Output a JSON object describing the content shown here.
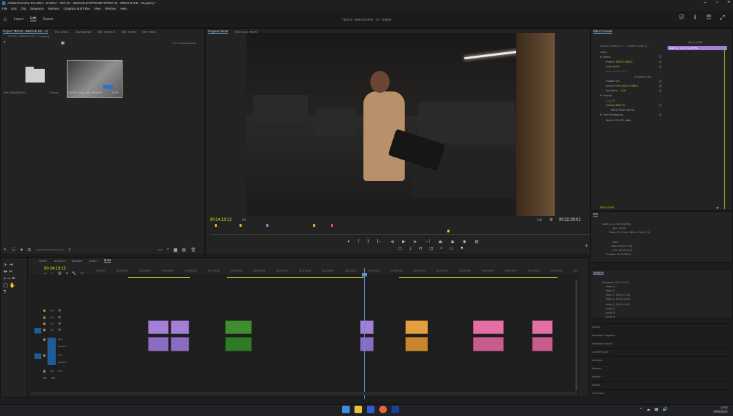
{
  "window": {
    "title": "Adobe Premiere Pro 2024 - E:\\2024 - TEC-IO - INNOV4LIFE\\PROJETO\\TECH3 - INNOV4LIFE - V1.prproj *"
  },
  "menu": [
    "File",
    "Edit",
    "Clip",
    "Sequence",
    "Markers",
    "Graphics and Titles",
    "View",
    "Window",
    "Help"
  ],
  "workspace": {
    "tabs": [
      "Import",
      "Edit",
      "Export"
    ],
    "active": "Edit",
    "project_title": "TECH3 - INNOV4LIFE - V1 - Edited"
  },
  "project_panel": {
    "tabs": [
      "Project: TECH3 - INNOV4LIFE - V1",
      "Bin: SARA",
      "Bin: ELENO",
      "Bin: NATALIA",
      "Bin: SARA",
      "Bin: TECH"
    ],
    "path": "TECH3 - INNOV4LIFE - V1.prproj",
    "search_placeholder": "",
    "selected_count": "1 of 2 items selected",
    "items": [
      {
        "name": "ENCERRAMENTO",
        "kind": "Folder",
        "meta": "9 items"
      },
      {
        "name": "INTRO_FULL_HD_FRONTE",
        "kind": "Clip",
        "meta": "10:00"
      }
    ]
  },
  "program_monitor": {
    "tabs": [
      "Program: MAIN",
      "Reference: MAIN"
    ],
    "timecode": "00:14:13:12",
    "fit": "Fit",
    "quality": "Full",
    "duration": "00:22:39:02"
  },
  "effect_controls": {
    "title": "Effect Controls",
    "source": "Source • CAM_A_17... • MAIN • CAM_A...",
    "timecode": "00:14:12:00",
    "clip_label": "CAM_A_17:00 FLORIPA",
    "rows": [
      {
        "label": "Video",
        "value": ""
      },
      {
        "label": "fx Motion",
        "value": ""
      },
      {
        "label": "Position",
        "value": "1920.0   1080.0"
      },
      {
        "label": "Scale",
        "value": "100.0"
      },
      {
        "label": "Scale Width",
        "value": "100.0"
      },
      {
        "label": "",
        "value": "Uniform Sc..."
      },
      {
        "label": "Rotation",
        "value": "0.0"
      },
      {
        "label": "Anchor Point",
        "value": "1920.0   1080.0"
      },
      {
        "label": "Anti-flicker...",
        "value": "0.00"
      },
      {
        "label": "fx Opacity",
        "value": ""
      },
      {
        "label": "Opacity",
        "value": "100.0 %"
      },
      {
        "label": "Blend Mode",
        "value": "Normal"
      },
      {
        "label": "fx Time Remapping",
        "value": ""
      },
      {
        "label": "Speed",
        "value": "100.00%"
      }
    ],
    "footer_tc": "00:14:13:12"
  },
  "info_panel": {
    "title": "Info",
    "lines": [
      "CAM_A_17:00 FLORIPA",
      "Type: Movie",
      "Video: 25.00 fps, 3840 x 2160 (1.0)",
      "Tape:",
      "Start: 00:14:07:04",
      "End: 00:14:16:00",
      "Duration: 00:00:08:22"
    ]
  },
  "markers_panel": {
    "title": "Markers",
    "lines": [
      "Sequence: 00:14:13:12",
      "Video 4:",
      "Video 3:",
      "Video 2: 00:00:17:23",
      "Video 1: 00:14:16:00",
      "Audio 1: 00:14:16:00",
      "Audio 2:",
      "Audio 3:",
      "Audio 4:"
    ]
  },
  "side_panels": [
    "Effects",
    "Essential Graphics",
    "Essential Sound",
    "Lumetri Color",
    "Libraries",
    "Markers",
    "History",
    "Events",
    "Timecode"
  ],
  "timeline": {
    "tabs": [
      "SARA",
      "NATALIA",
      "ELENO",
      "SARA",
      "MAIN"
    ],
    "active_tab": "MAIN",
    "timecode": "00:14:13:12",
    "ruler": [
      "00:00:00",
      "00:03:00:00",
      "00:04:00:00",
      "00:05:00:00",
      "00:06:00:00",
      "00:07:00:00",
      "00:08:00:00",
      "00:09:00:00",
      "00:10:00:00",
      "00:11:00:00",
      "00:12:00:00",
      "00:13:00:00",
      "00:14:00:00",
      "00:15:00:00",
      "00:16:00:00",
      "00:17:00:00",
      "00:18:00:00",
      "00:19:00:00",
      "00:20:00:00",
      "00:21:00:00",
      "00:22:00:00",
      "00:2"
    ],
    "tracks": [
      {
        "name": "V4"
      },
      {
        "name": "V3"
      },
      {
        "name": "V2"
      },
      {
        "name": "V1"
      },
      {
        "name": "A1",
        "label": "Audio 1"
      },
      {
        "name": "A2",
        "label": "Audio 2"
      },
      {
        "name": "A3"
      },
      {
        "name": "Mix",
        "value": "0.0"
      }
    ],
    "clip_colors": {
      "purple": "#a47fd6",
      "green": "#3e8e2f",
      "orange": "#e3a03c",
      "pink": "#e46fa6"
    }
  },
  "taskbar": {
    "time": "14:52",
    "date": "29/02/2024"
  }
}
